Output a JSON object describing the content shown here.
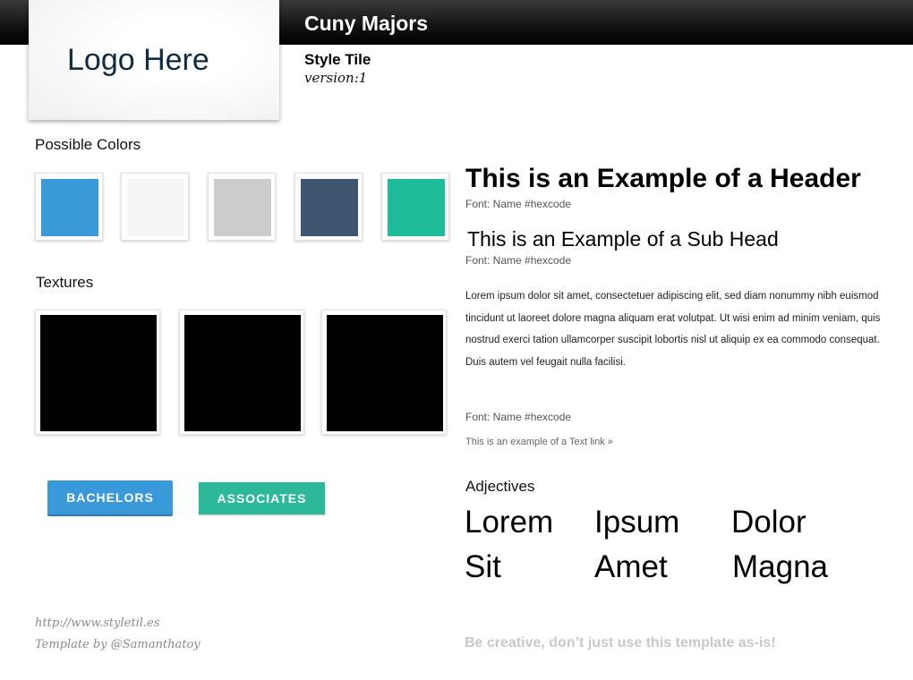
{
  "header": {
    "project_title": "Cuny Majors",
    "logo_text": "Logo Here",
    "style_tile_label": "Style Tile",
    "version_label": "version:1"
  },
  "colors_section": {
    "label": "Possible Colors",
    "swatches": [
      "#3a9ad9",
      "#f5f5f3",
      "#cccccc",
      "#3f5670",
      "#1dbc9a"
    ]
  },
  "textures_section": {
    "label": "Textures",
    "textures": [
      "#000000",
      "#000000",
      "#000000"
    ]
  },
  "buttons": {
    "bachelors": {
      "label": "BACHELORS",
      "color": "#3a9ad9"
    },
    "associates": {
      "label": "ASSOCIATES",
      "color": "#2bb99a"
    }
  },
  "typography": {
    "header": "This is an Example of a Header",
    "header_font_note": "Font: Name #hexcode",
    "subhead": "This is an Example of a Sub Head",
    "subhead_font_note": "Font: Name #hexcode",
    "body_text": "Lorem ipsum dolor sit amet, consectetuer adipiscing elit, sed diam nonummy nibh euismod tincidunt ut laoreet dolore magna aliquam erat volutpat. Ut wisi enim ad minim veniam, quis nostrud exerci tation ullamcorper suscipit lobortis nisl ut aliquip ex ea commodo consequat. Duis autem vel feugait nulla facilisi.",
    "body_font_note": "Font: Name #hexcode",
    "text_link": "This is an example of a Text link »"
  },
  "adjectives_section": {
    "label": "Adjectives",
    "words": [
      "Lorem",
      "Ipsum",
      "Dolor",
      "Sit",
      "Amet",
      "Magna"
    ]
  },
  "footer": {
    "url": "http://www.styletil.es",
    "credit": "Template by @Samanthatoy",
    "note": "Be creative, don’t just use this template as-is!"
  }
}
